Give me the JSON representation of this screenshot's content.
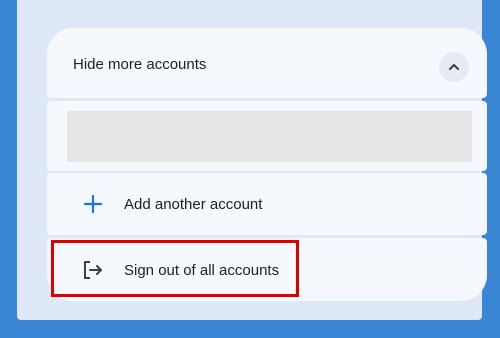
{
  "menu": {
    "header": {
      "label": "Hide more accounts",
      "icon": "chevron-up-icon"
    },
    "add_account": {
      "label": "Add another account",
      "icon": "plus-icon"
    },
    "sign_out": {
      "label": "Sign out of all accounts",
      "icon": "sign-out-icon"
    }
  },
  "colors": {
    "background": "#3a86d4",
    "panel": "#dfe8f6",
    "row": "#f5f8fd",
    "accent": "#1a73e8",
    "highlight": "#e00000"
  }
}
